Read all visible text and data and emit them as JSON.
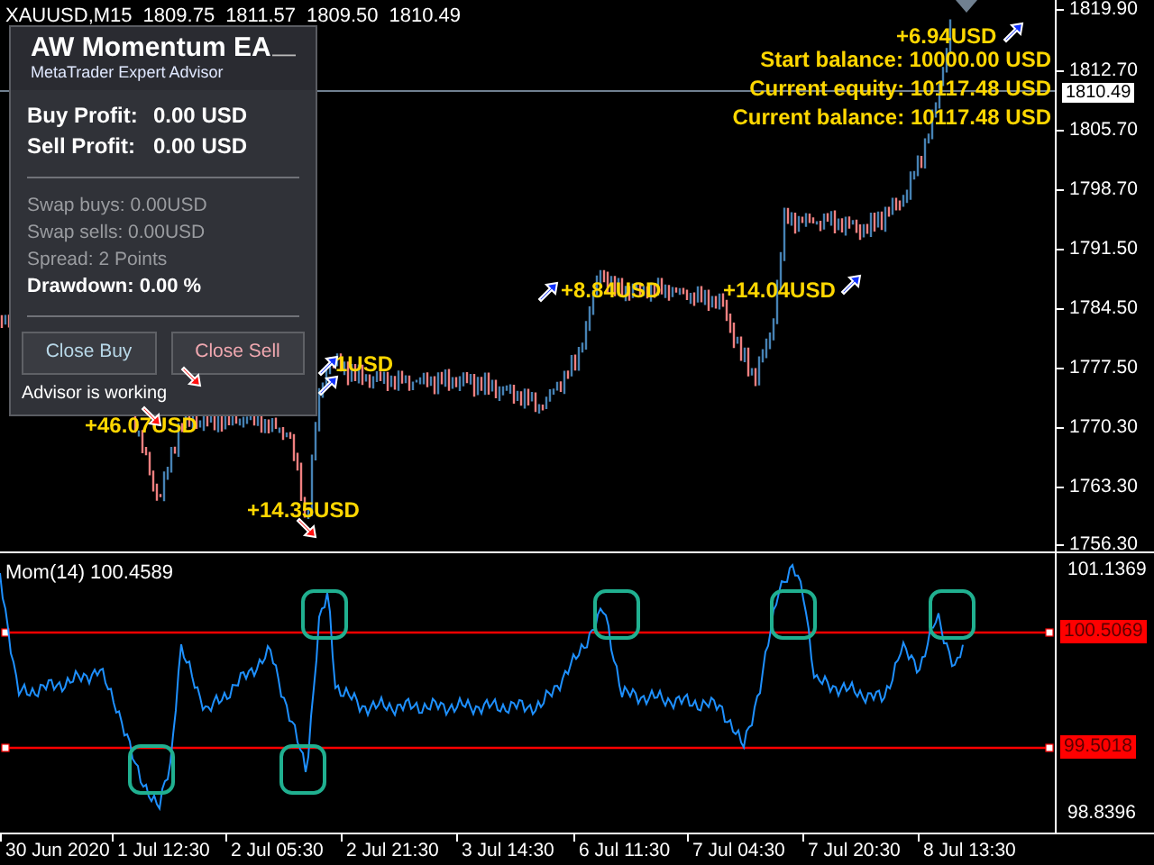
{
  "chart_header": {
    "symbol": "XAUUSD,M15",
    "ohlc": [
      "1809.75",
      "1811.57",
      "1809.50",
      "1810.49"
    ]
  },
  "account_info": [
    "Start balance: 10000.00 USD",
    "Current equity: 10117.48 USD",
    "Current balance: 10117.48 USD"
  ],
  "trade_labels": [
    "+6.94USD",
    "+8.84USD",
    "+14.04USD",
    "1USD",
    "+46.07USD",
    "+14.35USD"
  ],
  "trade_markers": [
    {
      "kind": "buy"
    },
    {
      "kind": "buy"
    },
    {
      "kind": "buy"
    },
    {
      "kind": "buy"
    },
    {
      "kind": "buy"
    },
    {
      "kind": "sell"
    },
    {
      "kind": "sell"
    },
    {
      "kind": "sell"
    }
  ],
  "ea_panel": {
    "title": "AW Momentum EA",
    "subtitle": "MetaTrader Expert Advisor",
    "minimize": "—",
    "profits": [
      {
        "label": "Buy Profit:",
        "value": "0.00 USD"
      },
      {
        "label": "Sell Profit:",
        "value": "0.00 USD"
      }
    ],
    "stats": [
      {
        "text": "Swap buys: 0.00USD",
        "emphasis": false
      },
      {
        "text": "Swap sells: 0.00USD",
        "emphasis": false
      },
      {
        "text": "Spread: 2 Points",
        "emphasis": false
      },
      {
        "text": "Drawdown: 0.00 %",
        "emphasis": true
      }
    ],
    "buttons": [
      {
        "label": "Close Buy",
        "kind": "buy"
      },
      {
        "label": "Close Sell",
        "kind": "sell"
      }
    ],
    "status": "Advisor is working"
  },
  "price_axis": {
    "labels": [
      "1819.90",
      "1812.70",
      "1805.70",
      "1798.70",
      "1791.50",
      "1784.50",
      "1777.50",
      "1770.30",
      "1763.30",
      "1756.30"
    ],
    "current_price": "1810.49"
  },
  "indicator": {
    "title": "Mom(14) 100.4589",
    "axis_labels": [
      "101.1369",
      "98.8396"
    ],
    "levels": [
      "100.5069",
      "99.5018"
    ]
  },
  "time_axis": [
    "30 Jun 2020",
    "1 Jul 12:30",
    "2 Jul 05:30",
    "2 Jul 21:30",
    "3 Jul 14:30",
    "6 Jul 11:30",
    "7 Jul 04:30",
    "7 Jul 20:30",
    "8 Jul 13:30"
  ]
}
